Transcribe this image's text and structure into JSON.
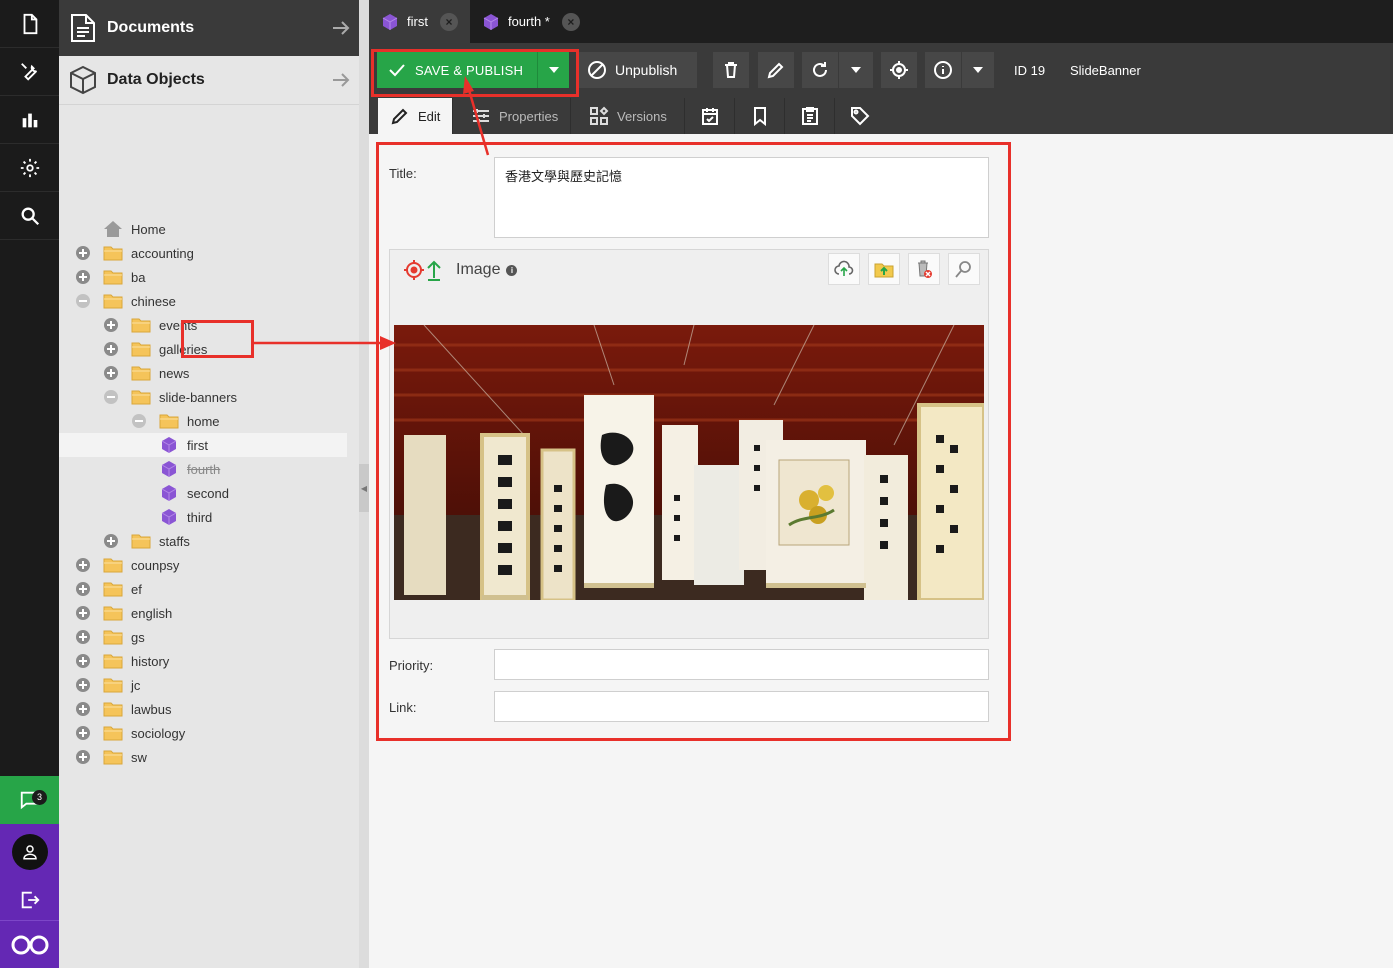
{
  "iconbar": {
    "items": [
      "document-icon",
      "wrench-icon",
      "bar-chart-icon",
      "gear-icon",
      "search-icon"
    ],
    "chat_badge": "3"
  },
  "tree": {
    "documents_title": "Documents",
    "data_objects_title": "Data Objects",
    "nodes": [
      {
        "label": "Home",
        "level": 0,
        "type": "home",
        "exp": "none"
      },
      {
        "label": "accounting",
        "level": 0,
        "type": "folder",
        "exp": "plus"
      },
      {
        "label": "ba",
        "level": 0,
        "type": "folder",
        "exp": "plus"
      },
      {
        "label": "chinese",
        "level": 0,
        "type": "folder",
        "exp": "minus"
      },
      {
        "label": "events",
        "level": 1,
        "type": "folder",
        "exp": "plus"
      },
      {
        "label": "galleries",
        "level": 1,
        "type": "folder",
        "exp": "plus"
      },
      {
        "label": "news",
        "level": 1,
        "type": "folder",
        "exp": "plus"
      },
      {
        "label": "slide-banners",
        "level": 1,
        "type": "folder",
        "exp": "minus"
      },
      {
        "label": "home",
        "level": 2,
        "type": "folder-open",
        "exp": "minus"
      },
      {
        "label": "first",
        "level": 3,
        "type": "object",
        "exp": "none",
        "selected": true
      },
      {
        "label": "fourth",
        "level": 3,
        "type": "object",
        "exp": "none",
        "strike": true
      },
      {
        "label": "second",
        "level": 3,
        "type": "object",
        "exp": "none"
      },
      {
        "label": "third",
        "level": 3,
        "type": "object",
        "exp": "none"
      },
      {
        "label": "staffs",
        "level": 1,
        "type": "folder",
        "exp": "plus"
      },
      {
        "label": "counpsy",
        "level": 0,
        "type": "folder",
        "exp": "plus"
      },
      {
        "label": "ef",
        "level": 0,
        "type": "folder",
        "exp": "plus"
      },
      {
        "label": "english",
        "level": 0,
        "type": "folder",
        "exp": "plus"
      },
      {
        "label": "gs",
        "level": 0,
        "type": "folder",
        "exp": "plus"
      },
      {
        "label": "history",
        "level": 0,
        "type": "folder",
        "exp": "plus"
      },
      {
        "label": "jc",
        "level": 0,
        "type": "folder",
        "exp": "plus"
      },
      {
        "label": "lawbus",
        "level": 0,
        "type": "folder",
        "exp": "plus"
      },
      {
        "label": "sociology",
        "level": 0,
        "type": "folder",
        "exp": "plus"
      },
      {
        "label": "sw",
        "level": 0,
        "type": "folder",
        "exp": "plus"
      }
    ]
  },
  "tabs": [
    {
      "label": "first",
      "active": true
    },
    {
      "label": "fourth *",
      "active": false
    }
  ],
  "toolbar": {
    "save_label": "SAVE & PUBLISH",
    "unpublish_label": "Unpublish",
    "id_label": "ID 19",
    "class_label": "SlideBanner"
  },
  "subtabs": {
    "edit": "Edit",
    "properties": "Properties",
    "versions": "Versions"
  },
  "form": {
    "title_label": "Title:",
    "title_value": "香港文學與歷史記憶",
    "image_label": "Image",
    "priority_label": "Priority:",
    "priority_value": "",
    "link_label": "Link:",
    "link_value": ""
  },
  "colors": {
    "accent_green": "#27a548",
    "sidebar_purple": "#6428b4",
    "annotation_red": "#e8302a",
    "object_cube": "#8a55d4"
  }
}
